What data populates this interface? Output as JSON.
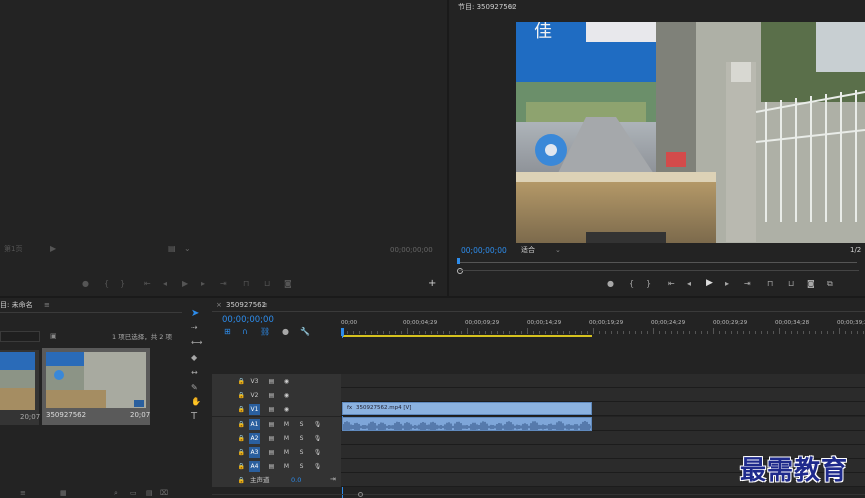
{
  "source_monitor": {
    "timecode_left": "第1页",
    "timecode_right": "00;00;00;00"
  },
  "program_monitor": {
    "title": "节目: 350927562",
    "timecode": "00;00;00;00",
    "fit_label": "适合",
    "resolution": "1/2",
    "video_signboard_text": "佳"
  },
  "project_panel": {
    "title": "目: 未命名",
    "selection_info": "1 项已选择，共 2 项",
    "items": [
      {
        "name": "",
        "duration": "20;07"
      },
      {
        "name": "350927562",
        "duration": "20;07"
      }
    ]
  },
  "timeline": {
    "tab_label": "350927562",
    "timecode": "00;00;00;00",
    "ruler_labels": [
      "00;00",
      "00;00;04;29",
      "00;00;09;29",
      "00;00;14;29",
      "00;00;19;29",
      "00;00;24;29",
      "00;00;29;29",
      "00;00;34;28",
      "00;00;39;28"
    ],
    "video_tracks": [
      "V3",
      "V2",
      "V1"
    ],
    "audio_tracks": [
      "A1",
      "A2",
      "A3",
      "A4"
    ],
    "master_label": "主声道",
    "master_value": "0.0",
    "video_clip_label": "350927562.mp4 [V]",
    "m_label": "M",
    "s_label": "S"
  },
  "watermark": "最需教育",
  "colors": {
    "accent": "#2d8ceb",
    "clip_video": "#8bb2e0",
    "clip_audio": "#7ea6d9",
    "work_area": "#d6c21f"
  }
}
